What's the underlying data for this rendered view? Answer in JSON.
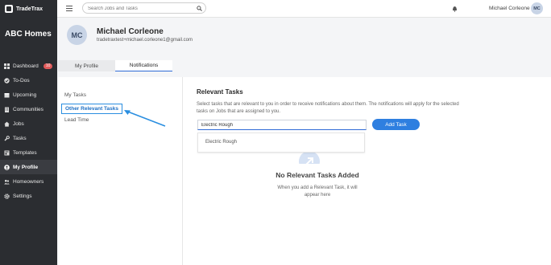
{
  "app": {
    "brand": "TradeTrax",
    "company": "ABC Homes"
  },
  "sidebar": {
    "items": [
      {
        "label": "Dashboard",
        "icon": "grid-icon",
        "badge": "10"
      },
      {
        "label": "To-Dos",
        "icon": "check-circle-icon"
      },
      {
        "label": "Upcoming",
        "icon": "calendar-icon"
      },
      {
        "label": "Communities",
        "icon": "building-icon"
      },
      {
        "label": "Jobs",
        "icon": "home-icon"
      },
      {
        "label": "Tasks",
        "icon": "wrench-icon"
      },
      {
        "label": "Templates",
        "icon": "template-icon"
      },
      {
        "label": "My Profile",
        "icon": "user-icon",
        "active": true
      },
      {
        "label": "Homeowners",
        "icon": "people-icon"
      },
      {
        "label": "Settings",
        "icon": "gear-icon"
      }
    ]
  },
  "topbar": {
    "search_placeholder": "Search Jobs and Tasks",
    "user_name": "Michael Corleone",
    "user_initials": "MC"
  },
  "profile": {
    "initials": "MC",
    "name": "Michael Corleone",
    "email": "tradetraxtest+michael.corleone1@gmail.com"
  },
  "tabs": [
    {
      "label": "My Profile"
    },
    {
      "label": "Notifications",
      "active": true
    }
  ],
  "notifications_menu": [
    {
      "label": "My Tasks"
    },
    {
      "label": "Other Relevant Tasks",
      "highlighted": true
    },
    {
      "label": "Lead Time"
    }
  ],
  "relevant_tasks": {
    "title": "Relevant Tasks",
    "description": "Select tasks that are relevant to you in order to receive notifications about them. The notifications will apply for the selected tasks on Jobs that are assigned to you.",
    "input_value": "Electric Rough",
    "add_button": "Add Task",
    "dropdown_option": "Electric Rough",
    "empty_title": "No Relevant Tasks Added",
    "empty_subtitle": "When you add a Relevant Task, it will appear here"
  },
  "colors": {
    "sidebar_bg": "#2b2d31",
    "accent": "#2e7fe0",
    "highlight_border": "#2a8ee0",
    "badge": "#e05a5a"
  }
}
